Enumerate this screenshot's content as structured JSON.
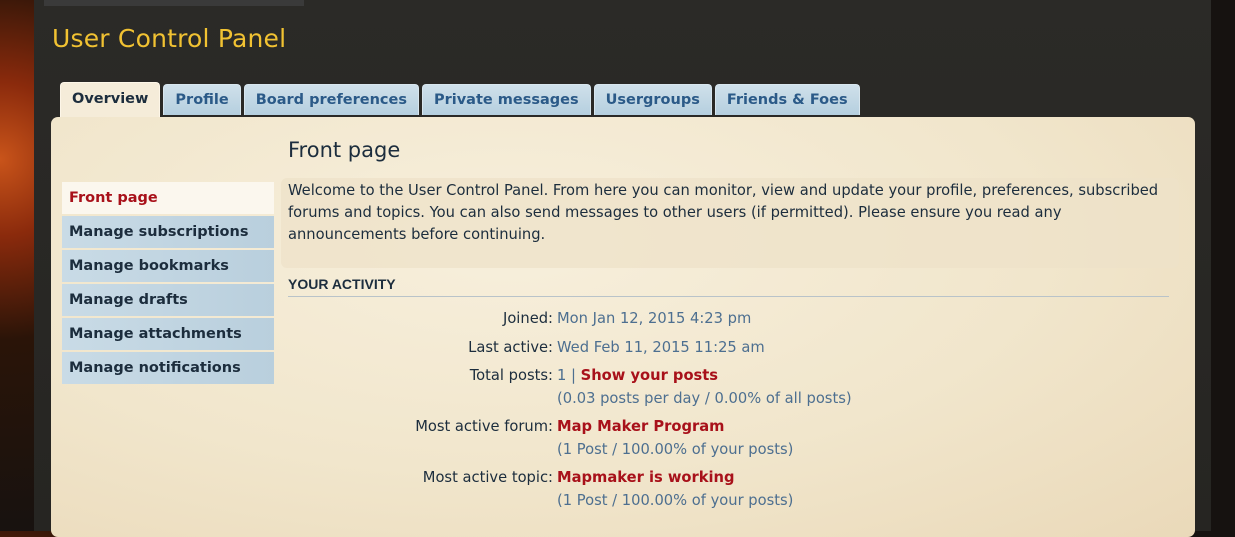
{
  "header": {
    "title": "User Control Panel"
  },
  "tabs": [
    {
      "label": "Overview"
    },
    {
      "label": "Profile"
    },
    {
      "label": "Board preferences"
    },
    {
      "label": "Private messages"
    },
    {
      "label": "Usergroups"
    },
    {
      "label": "Friends & Foes"
    }
  ],
  "sidebar": {
    "items": [
      {
        "label": "Front page"
      },
      {
        "label": "Manage subscriptions"
      },
      {
        "label": "Manage bookmarks"
      },
      {
        "label": "Manage drafts"
      },
      {
        "label": "Manage attachments"
      },
      {
        "label": "Manage notifications"
      }
    ]
  },
  "main": {
    "heading": "Front page",
    "intro": "Welcome to the User Control Panel. From here you can monitor, view and update your profile, preferences, subscribed forums and topics. You can also send messages to other users (if permitted). Please ensure you read any announcements before continuing.",
    "activity_title": "YOUR ACTIVITY",
    "joined_label": "Joined:",
    "joined_value": "Mon Jan 12, 2015 4:23 pm",
    "last_active_label": "Last active:",
    "last_active_value": "Wed Feb 11, 2015 11:25 am",
    "total_posts_label": "Total posts:",
    "total_posts_value": "1 |",
    "show_posts_link": "Show your posts",
    "posts_stats": "(0.03 posts per day / 0.00% of all posts)",
    "active_forum_label": "Most active forum:",
    "active_forum_link": "Map Maker Program",
    "active_forum_stats": "(1 Post / 100.00% of your posts)",
    "active_topic_label": "Most active topic:",
    "active_topic_link": "Mapmaker is working",
    "active_topic_stats": "(1 Post / 100.00% of your posts)"
  }
}
